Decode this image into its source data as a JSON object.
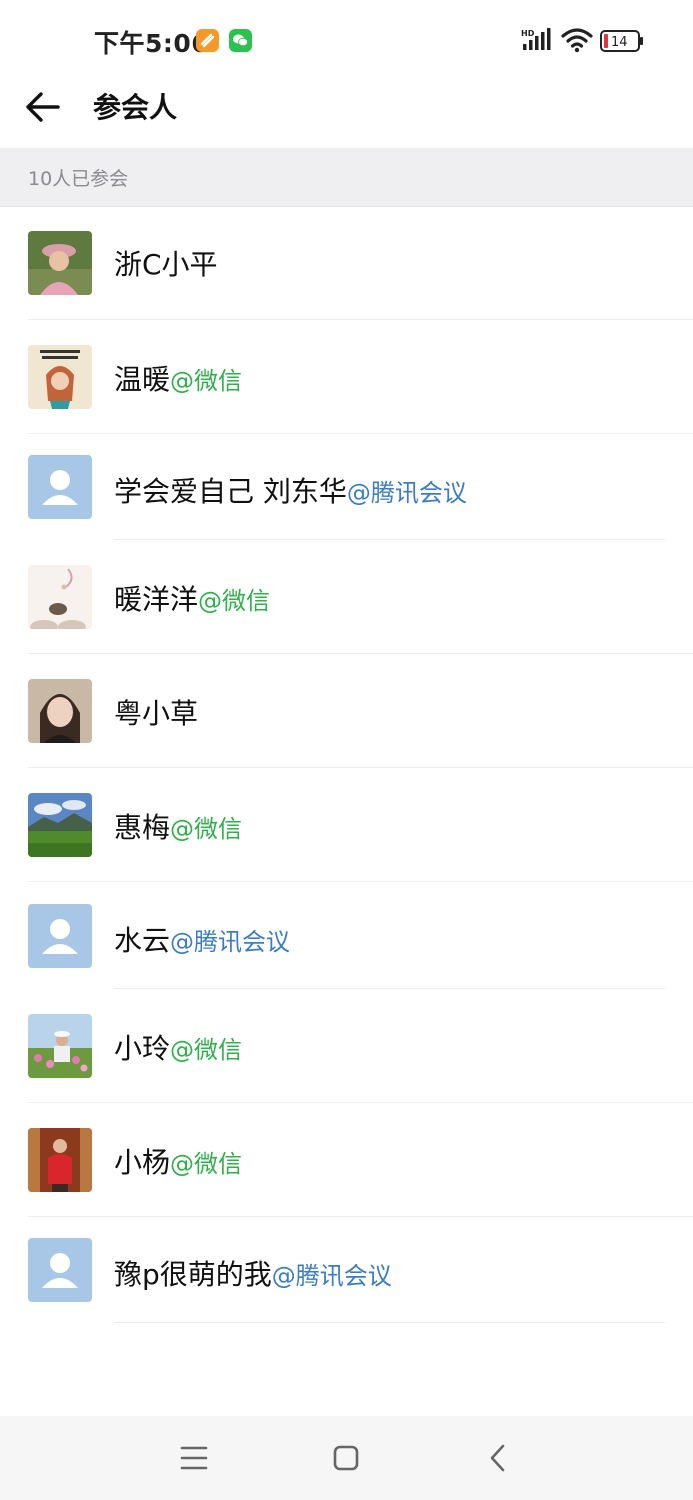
{
  "status_bar": {
    "time": "下午5:06",
    "battery": "14",
    "signal_label": "HD",
    "icons": [
      "orange-app-icon",
      "wechat-icon",
      "signal-icon",
      "wifi-icon",
      "battery-icon"
    ]
  },
  "header": {
    "title": "参会人",
    "back_icon": "arrow-left-icon"
  },
  "section": {
    "count_label": "10人已参会"
  },
  "participants": [
    {
      "name": "浙C小平",
      "suffix": "",
      "kind": "none",
      "avatar": "photo"
    },
    {
      "name": "温暖",
      "suffix": "@微信",
      "kind": "wx",
      "avatar": "photo"
    },
    {
      "name": "学会爱自己 刘东华",
      "suffix": "@腾讯会议",
      "kind": "tm",
      "avatar": "default"
    },
    {
      "name": "暖洋洋",
      "suffix": "@微信",
      "kind": "wx",
      "avatar": "photo"
    },
    {
      "name": "粤小草",
      "suffix": "",
      "kind": "none",
      "avatar": "photo"
    },
    {
      "name": "惠梅",
      "suffix": "@微信",
      "kind": "wx",
      "avatar": "photo"
    },
    {
      "name": "水云",
      "suffix": "@腾讯会议",
      "kind": "tm",
      "avatar": "default"
    },
    {
      "name": "小玲",
      "suffix": "@微信",
      "kind": "wx",
      "avatar": "photo"
    },
    {
      "name": "小杨",
      "suffix": "@微信",
      "kind": "wx",
      "avatar": "photo"
    },
    {
      "name": "豫p很萌的我",
      "suffix": "@腾讯会议",
      "kind": "tm",
      "avatar": "default"
    }
  ],
  "colors": {
    "wechat_suffix": "#2fb04b",
    "tencent_meeting_suffix": "#3b7cc8",
    "default_avatar": "#a8c6e6",
    "section_bg": "#efeff1"
  },
  "nav": {
    "icons": [
      "menu-icon",
      "home-icon",
      "back-nav-icon"
    ]
  }
}
